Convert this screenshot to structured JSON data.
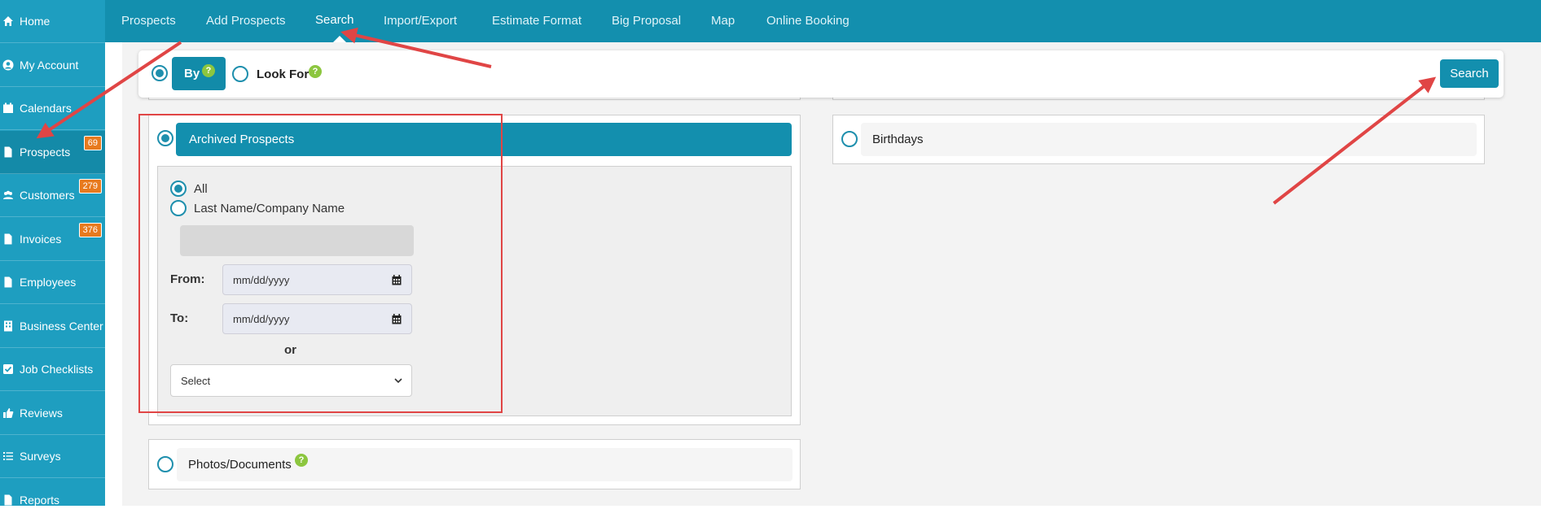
{
  "sidebar": {
    "items": [
      {
        "label": "Home",
        "icon": "home-icon"
      },
      {
        "label": "My Account",
        "icon": "user-circle-icon"
      },
      {
        "label": "Calendars",
        "icon": "calendar-icon"
      },
      {
        "label": "Prospects",
        "icon": "file-icon",
        "badge": "69"
      },
      {
        "label": "Customers",
        "icon": "users-icon",
        "badge": "279"
      },
      {
        "label": "Invoices",
        "icon": "file-icon",
        "badge": "376"
      },
      {
        "label": "Employees",
        "icon": "file-icon"
      },
      {
        "label": "Business Center",
        "icon": "building-icon"
      },
      {
        "label": "Job Checklists",
        "icon": "check-square-icon"
      },
      {
        "label": "Reviews",
        "icon": "thumbs-up-icon"
      },
      {
        "label": "Surveys",
        "icon": "list-icon"
      },
      {
        "label": "Reports",
        "icon": "file-icon"
      }
    ]
  },
  "topnav": {
    "tabs": [
      "Prospects",
      "Add Prospects",
      "Search",
      "Import/Export",
      "Estimate Format",
      "Big Proposal",
      "Map",
      "Online Booking"
    ],
    "active": "Search"
  },
  "search_bar": {
    "by_label": "By",
    "look_for_label": "Look For",
    "help_glyph": "?",
    "search_button": "Search"
  },
  "archived": {
    "title": "Archived Prospects",
    "option_all": "All",
    "option_name": "Last Name/Company Name",
    "from_label": "From:",
    "to_label": "To:",
    "date_placeholder": "mm/dd/yyyy",
    "or_label": "or",
    "select_value": "Select"
  },
  "birthdays": {
    "title": "Birthdays"
  },
  "photos": {
    "title": "Photos/Documents"
  },
  "colors": {
    "sidebar": "#1e9ec0",
    "topbar": "#138fae",
    "badge": "#e87a1e",
    "help": "#8cc63f",
    "annotation": "#e04545"
  }
}
